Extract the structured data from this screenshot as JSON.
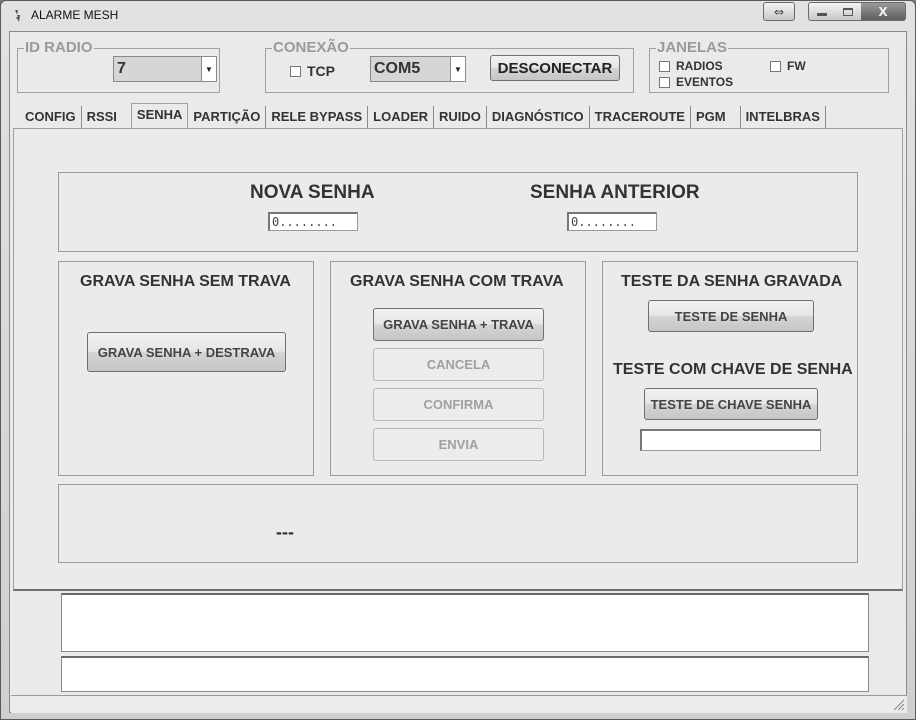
{
  "window": {
    "title": "ALARME MESH",
    "controls": {
      "resize": "⇔",
      "minimize": "—",
      "maximize": "▫",
      "close": "X"
    }
  },
  "id_radio": {
    "label": "ID RADIO",
    "selected": "7"
  },
  "conexao": {
    "label": "CONEXÃO",
    "tcp_label": "TCP",
    "tcp_checked": false,
    "port_selected": "COM5",
    "disconnect_label": "DESCONECTAR"
  },
  "janelas": {
    "label": "JANELAS",
    "radios_label": "RADIOS",
    "eventos_label": "EVENTOS",
    "fw_label": "FW"
  },
  "tabs": [
    {
      "label": "CONFIG"
    },
    {
      "label": "RSSI"
    },
    {
      "label": "SENHA",
      "active": true
    },
    {
      "label": "PARTIÇÃO"
    },
    {
      "label": "RELE BYPASS"
    },
    {
      "label": "LOADER"
    },
    {
      "label": "RUIDO"
    },
    {
      "label": "DIAGNÓSTICO"
    },
    {
      "label": "TRACEROUTE"
    },
    {
      "label": "PGM"
    },
    {
      "label": "INTELBRAS"
    }
  ],
  "senha": {
    "nova_senha_label": "NOVA SENHA",
    "nova_senha_value": "0........",
    "senha_anterior_label": "SENHA ANTERIOR",
    "senha_anterior_value": "0........",
    "sem_trava": {
      "title": "GRAVA SENHA SEM TRAVA",
      "button": "GRAVA SENHA + DESTRAVA"
    },
    "com_trava": {
      "title": "GRAVA SENHA COM TRAVA",
      "button": "GRAVA SENHA + TRAVA",
      "cancel": "CANCELA",
      "confirm": "CONFIRMA",
      "send": "ENVIA"
    },
    "teste": {
      "title": "TESTE DA SENHA GRAVADA",
      "button": "TESTE DE SENHA",
      "chave_title": "TESTE COM CHAVE DE SENHA",
      "chave_button": "TESTE DE CHAVE SENHA",
      "chave_value": ""
    },
    "status": "---"
  },
  "log": {
    "output": "",
    "input": ""
  }
}
